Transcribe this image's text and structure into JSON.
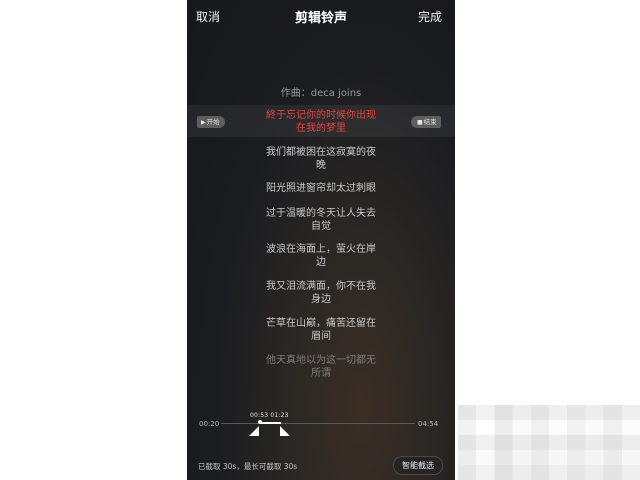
{
  "header": {
    "cancel_label": "取消",
    "title": "剪辑铃声",
    "done_label": "完成"
  },
  "lyrics": {
    "composer": "作曲：deca joins",
    "lines": [
      "終于忘记你的时候你出现",
      "在我的梦里",
      "我们都被困在这寂寞的夜",
      "晚",
      "阳光照进窗帘却太过刺眼",
      "过于温暖的冬天让人失去",
      "自觉",
      "波浪在海面上，萤火在岸",
      "边",
      "我又泪流满面，你不在我",
      "身边",
      "芒草在山巅，痛苦还留在",
      "眉间",
      "他天真地以为这一切都无",
      "所谓"
    ]
  },
  "markers": {
    "start_label": "开始",
    "end_label": "结束"
  },
  "timeline": {
    "start_time": "00:20",
    "end_time": "04:54",
    "selection_start": "00:53",
    "selection_end": "01:23",
    "selection_times_label": "00:53 01:23"
  },
  "footer": {
    "info": "已截取 30s，最长可截取 30s",
    "smart_button_label": "智能截选"
  },
  "colors": {
    "background": "#1b1c20",
    "active_lyric": "#e0463f",
    "text": "#c9c9c9"
  }
}
